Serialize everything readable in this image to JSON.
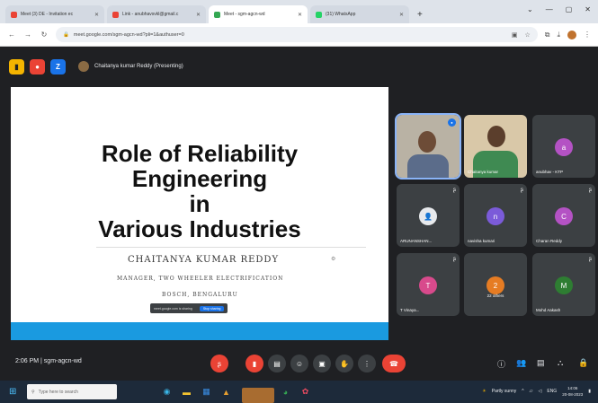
{
  "browser": {
    "tabs": [
      {
        "label": "Meet (3) DE - Invitation ec",
        "color": "#ea4335"
      },
      {
        "label": "Link - anubhavsvkl@gmail.c",
        "color": "#ea4335"
      },
      {
        "label": "Meet - sgm-agcn-wd",
        "color": "#34a853",
        "active": true
      },
      {
        "label": "(31) WhatsApp",
        "color": "#25d366"
      }
    ],
    "url": "meet.google.com/sgm-agcn-wd?pli=1&authuser=0"
  },
  "meet": {
    "presenter_label": "Chaitanya kumar Reddy (Presenting)",
    "extensions": [
      "ext-yellow-icon",
      "ext-red-icon",
      "ext-zoom-icon"
    ],
    "slide": {
      "title_lines": [
        "Role of Reliability",
        "Engineering",
        "in",
        "Various Industries"
      ],
      "author": "CHAITANYA KUMAR REDDY",
      "role": "MANAGER, TWO WHEELER ELECTRIFICATION",
      "org": "BOSCH, BENGALURU",
      "stop_text": "meet.google.com is sharing",
      "stop_button": "Stop sharing"
    },
    "participants": [
      {
        "name": "",
        "type": "video",
        "speaking": true
      },
      {
        "name": "Chaitanya kumar",
        "type": "video"
      },
      {
        "name": "anubhav - KTP",
        "initial": "a",
        "color": "#b452c4"
      },
      {
        "name": "ARUNANSHAN...",
        "type": "video-dim"
      },
      {
        "name": "navisha kumari",
        "initial": "n",
        "color": "#7b5bd9"
      },
      {
        "name": "Charan Reddy",
        "initial": "C",
        "color": "#b452c4"
      },
      {
        "name": "T Vinaya...",
        "initial": "T",
        "color": "#d84a8c"
      },
      {
        "name": "22 others",
        "initial": "2",
        "color": "#e67c23"
      },
      {
        "name": "Mohd Aakash",
        "initial": "M",
        "color": "#2e7d32"
      }
    ],
    "clock": "2:06 PM",
    "meeting_code": "sgm-agcn-wd"
  },
  "taskbar": {
    "search_placeholder": "Type here to search",
    "weather": "Partly sunny",
    "time": "14:06",
    "date": "20-08-2023",
    "lang": "ENG"
  }
}
